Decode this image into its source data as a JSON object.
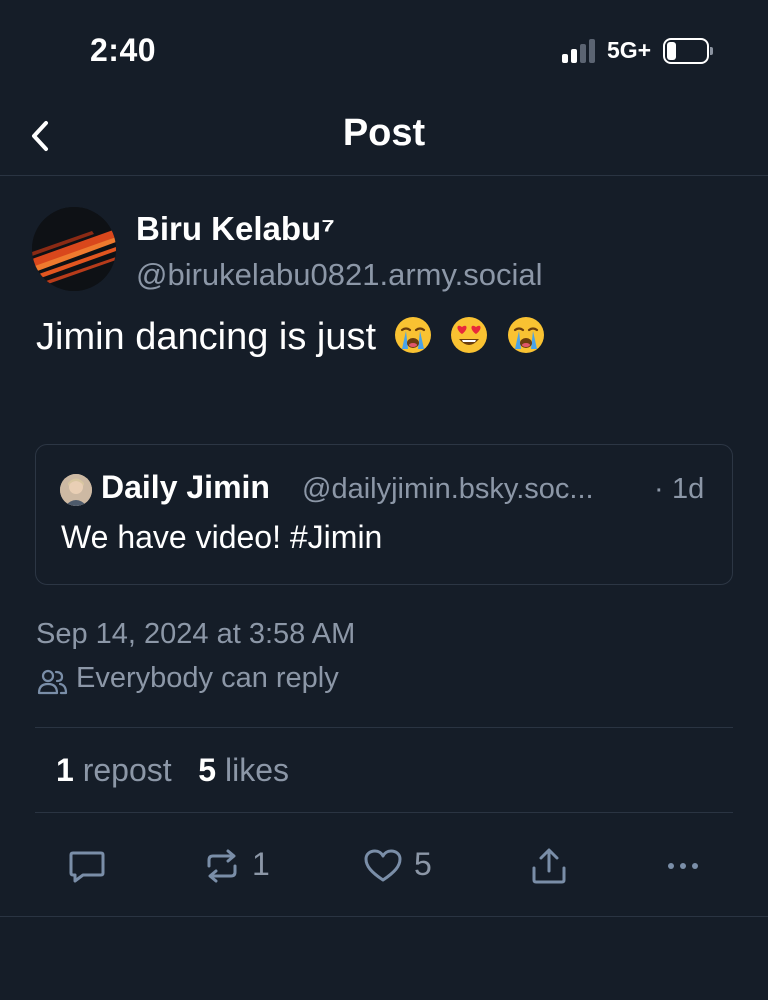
{
  "status_bar": {
    "time": "2:40",
    "network": "5G+",
    "icons": [
      "signal-icon",
      "battery-icon"
    ]
  },
  "header": {
    "title": "Post",
    "back_icon": "chevron-left-icon"
  },
  "post": {
    "author": {
      "display_name": "Biru Kelabu⁷",
      "handle": "@birukelabu0821.army.social"
    },
    "text": "Jimin dancing is just",
    "emojis": [
      "loudly-crying-face",
      "smiling-face-with-heart-eyes",
      "loudly-crying-face"
    ],
    "quote": {
      "display_name": "Daily Jimin",
      "handle": "@dailyjimin.bsky.soc...",
      "separator": "·",
      "time": "1d",
      "text": "We have video! #Jimin"
    },
    "timestamp": "Sep 14, 2024 at 3:58 AM",
    "reply_setting": "Everybody can reply",
    "stats": {
      "reposts": "1",
      "reposts_label": "repost",
      "likes": "5",
      "likes_label": "likes"
    },
    "actions": {
      "reply": {
        "icon": "reply-icon"
      },
      "repost": {
        "icon": "repost-icon",
        "count": "1"
      },
      "like": {
        "icon": "heart-icon",
        "count": "5"
      },
      "share": {
        "icon": "share-icon"
      },
      "more": {
        "icon": "more-icon"
      }
    }
  },
  "colors": {
    "background": "#151d28",
    "text": "#ffffff",
    "muted": "#8c97a7",
    "icon": "#7a8ea8",
    "border": "#2a3442"
  }
}
